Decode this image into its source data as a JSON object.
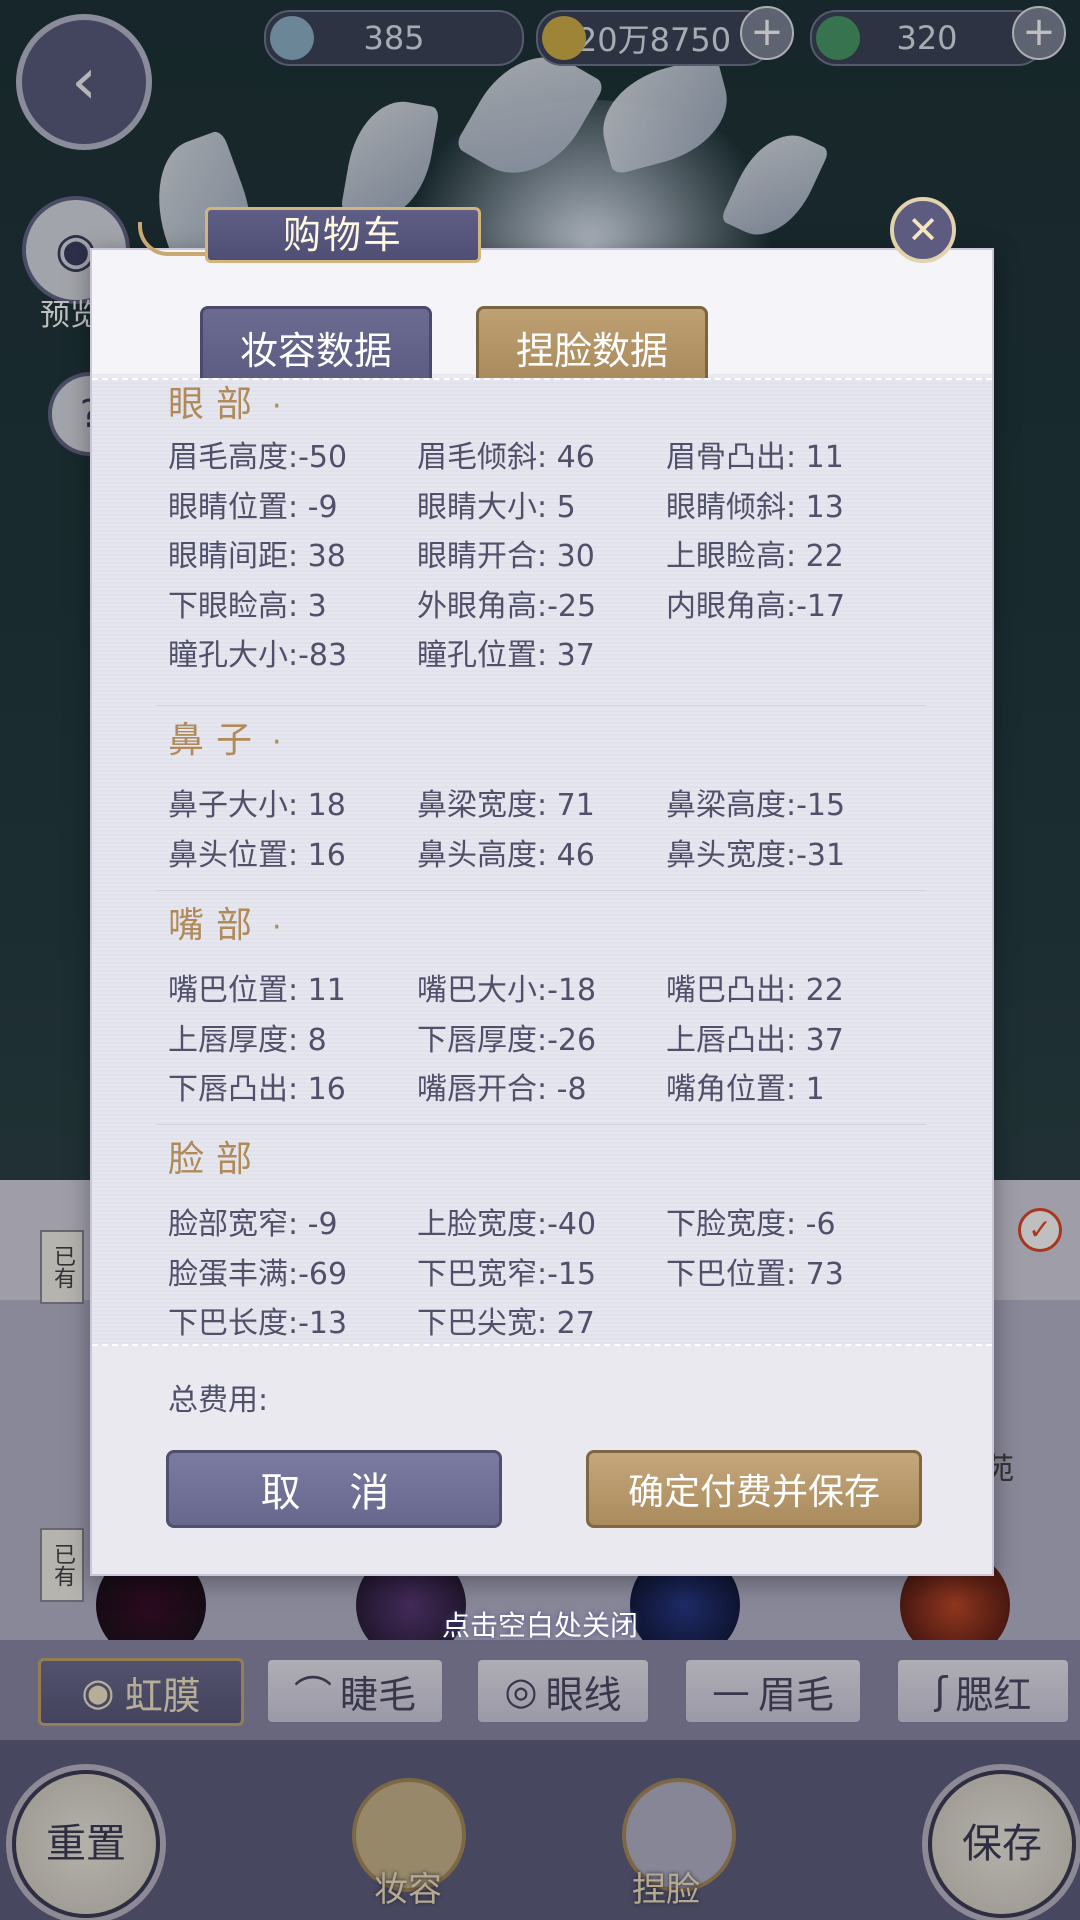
{
  "hud": {
    "resource1": "385",
    "resource2": "20万8750",
    "resource3": "320",
    "preview_label": "预览",
    "help_icon": "question-mark"
  },
  "modal": {
    "title": "购物车",
    "tabs": [
      {
        "label": "妆容数据"
      },
      {
        "label": "捏脸数据"
      }
    ],
    "sections": [
      {
        "title": "眼部",
        "items": [
          "眉毛高度:-50",
          "眉毛倾斜: 46",
          "眉骨凸出: 11",
          "眼睛位置: -9",
          "眼睛大小:  5",
          "眼睛倾斜: 13",
          "眼睛间距: 38",
          "眼睛开合: 30",
          "上眼睑高: 22",
          "下眼睑高:  3",
          "外眼角高:-25",
          "内眼角高:-17",
          "瞳孔大小:-83",
          "瞳孔位置: 37"
        ]
      },
      {
        "title": "鼻子",
        "items": [
          "鼻子大小: 18",
          "鼻梁宽度: 71",
          "鼻梁高度:-15",
          "鼻头位置: 16",
          "鼻头高度: 46",
          "鼻头宽度:-31"
        ]
      },
      {
        "title": "嘴部",
        "items": [
          "嘴巴位置: 11",
          "嘴巴大小:-18",
          "嘴巴凸出: 22",
          "上唇厚度:  8",
          "下唇厚度:-26",
          "上唇凸出: 37",
          "下唇凸出: 16",
          "嘴唇开合: -8",
          "嘴角位置:  1"
        ]
      },
      {
        "title": "脸部",
        "items": [
          "脸部宽窄: -9",
          "上脸宽度:-40",
          "下脸宽度: -6",
          "脸蛋丰满:-69",
          "下巴宽窄:-15",
          "下巴位置: 73",
          "下巴长度:-13",
          "下巴尖宽: 27"
        ]
      }
    ],
    "total_label": "总费用:",
    "cancel_label": "取 消",
    "confirm_label": "确定付费并保存",
    "close_hint": "点击空白处关闭"
  },
  "background": {
    "owned_tag": "已有",
    "partial_tag_right": "苑",
    "category_tabs": [
      {
        "label": "虹膜",
        "icon": "iris-icon"
      },
      {
        "label": "睫毛",
        "icon": "eyelash-icon"
      },
      {
        "label": "眼线",
        "icon": "eye-icon"
      },
      {
        "label": "眉毛",
        "icon": "eyebrow-icon"
      },
      {
        "label": "腮红",
        "icon": "blush-icon"
      }
    ],
    "bottom": {
      "reset": "重置",
      "makeup": "妆容",
      "face": "捏脸",
      "save": "保存"
    }
  },
  "colors": {
    "accent_gold": "#b08a58",
    "purple_button": "#6c6b91",
    "gold_button": "#bea072"
  }
}
